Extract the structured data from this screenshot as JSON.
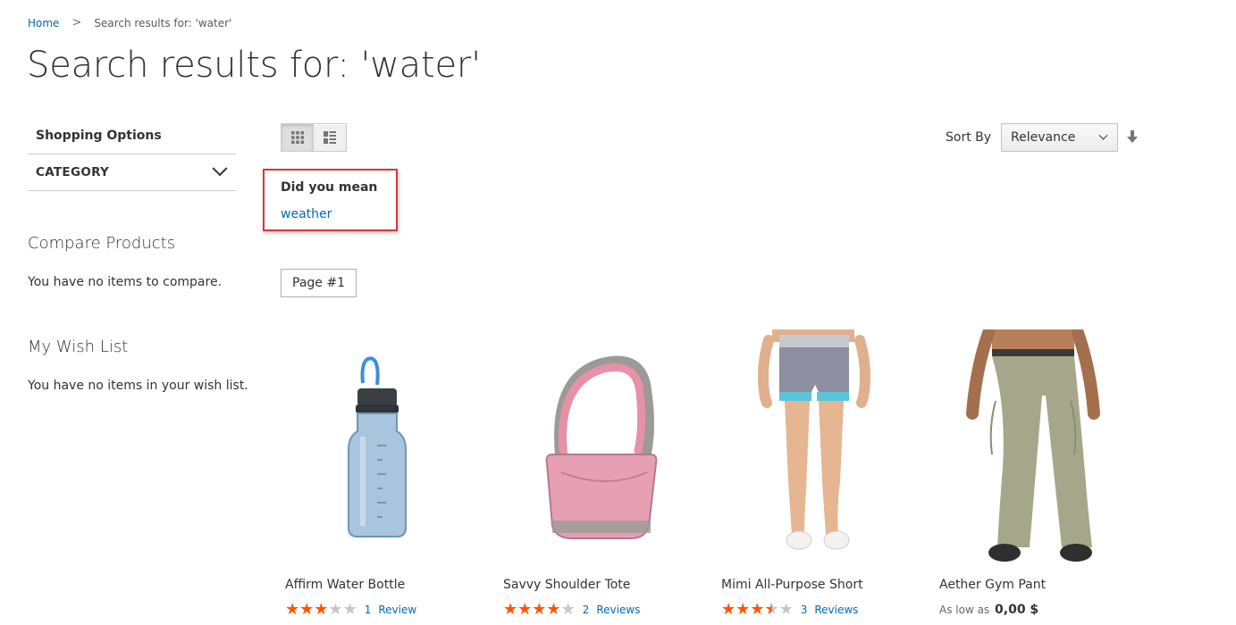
{
  "breadcrumb": {
    "home": "Home",
    "separator": ">",
    "current": "Search results for: 'water'"
  },
  "page_title": "Search results for: 'water'",
  "sidebar": {
    "shopping_options": "Shopping Options",
    "filter_category": "CATEGORY",
    "compare": {
      "title": "Compare Products",
      "text": "You have no items to compare."
    },
    "wishlist": {
      "title": "My Wish List",
      "text": "You have no items in your wish list."
    }
  },
  "toolbar": {
    "modes": [
      {
        "icon": "grid-icon",
        "active": true
      },
      {
        "icon": "list-icon",
        "active": false
      }
    ],
    "sort_label": "Sort By",
    "sort_value": "Relevance",
    "sort_direction_icon": "arrow-down-icon"
  },
  "did_you_mean": {
    "title": "Did you mean",
    "suggestion": "weather",
    "highlight_color": "#d43a3a"
  },
  "page_button": "Page #1",
  "products": [
    {
      "name": "Affirm Water Bottle",
      "rating": 3,
      "max_rating": 5,
      "review_count": "1",
      "review_label": "Review"
    },
    {
      "name": "Savvy Shoulder Tote",
      "rating": 4,
      "max_rating": 5,
      "review_count": "2",
      "review_label": "Reviews"
    },
    {
      "name": "Mimi All-Purpose Short",
      "rating": 3.5,
      "max_rating": 5,
      "review_count": "3",
      "review_label": "Reviews"
    },
    {
      "name": "Aether Gym Pant",
      "price_prefix": "As low as",
      "price": "0,00 $"
    }
  ],
  "colors": {
    "link": "#006bb4",
    "star": "#ff5501",
    "star_empty": "#c7c7c7"
  }
}
